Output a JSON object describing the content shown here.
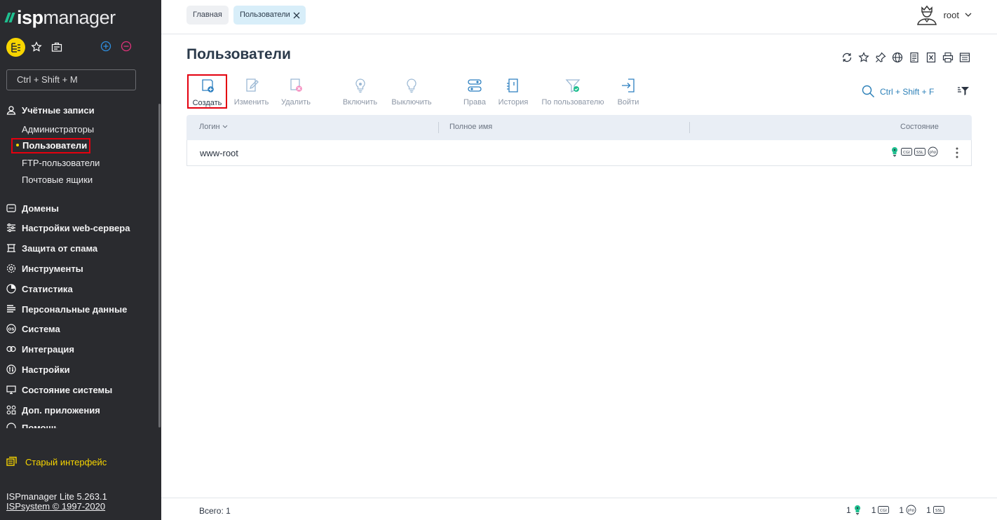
{
  "brand": {
    "logo_prefix": "isp",
    "logo_suffix": "manager",
    "accent": "#f7d500",
    "logo_color": "#1fbf8f"
  },
  "sidebar": {
    "hotkey_hint": "Ctrl + Shift + M",
    "accounts": {
      "label": "Учётные записи",
      "items": [
        {
          "label": "Администраторы"
        },
        {
          "label": "Пользователи",
          "active": true
        },
        {
          "label": "FTP-пользователи"
        },
        {
          "label": "Почтовые ящики"
        }
      ]
    },
    "sections": [
      {
        "label": "Домены",
        "icon": "domain-icon"
      },
      {
        "label": "Настройки web-сервера",
        "icon": "sliders-icon"
      },
      {
        "label": "Защита от спама",
        "icon": "shield-icon"
      },
      {
        "label": "Инструменты",
        "icon": "gear-icon"
      },
      {
        "label": "Статистика",
        "icon": "pie-chart-icon"
      },
      {
        "label": "Персональные данные",
        "icon": "list-icon"
      },
      {
        "label": "Система",
        "icon": "os-icon"
      },
      {
        "label": "Интеграция",
        "icon": "integration-icon"
      },
      {
        "label": "Настройки",
        "icon": "settings-icon"
      },
      {
        "label": "Состояние системы",
        "icon": "monitor-icon"
      },
      {
        "label": "Доп. приложения",
        "icon": "apps-icon"
      },
      {
        "label": "Помощь",
        "icon": "help-icon"
      }
    ],
    "old_interface": "Старый интерфейс",
    "version": "ISPmanager Lite 5.263.1",
    "copyright": "ISPsystem © 1997-2020"
  },
  "topbar": {
    "tabs": [
      {
        "label": "Главная"
      },
      {
        "label": "Пользователи"
      }
    ],
    "user": "root"
  },
  "page": {
    "title": "Пользователи"
  },
  "toolbar": {
    "buttons": [
      {
        "label": "Создать"
      },
      {
        "label": "Изменить"
      },
      {
        "label": "Удалить"
      },
      {
        "label": "Включить"
      },
      {
        "label": "Выключить"
      },
      {
        "label": "Права"
      },
      {
        "label": "История"
      },
      {
        "label": "По пользователю"
      },
      {
        "label": "Войти"
      }
    ],
    "search_hint": "Ctrl + Shift + F"
  },
  "table": {
    "columns": [
      {
        "label": "Логин"
      },
      {
        "label": "Полное имя"
      },
      {
        "label": "Состояние"
      }
    ],
    "rows": [
      {
        "login": "www-root",
        "full_name": "",
        "status_icons": [
          "key-icon",
          "cgi-icon",
          "ssl-icon",
          "php-icon"
        ]
      }
    ]
  },
  "footer": {
    "total": "Всего: 1",
    "stats": [
      {
        "count": "1",
        "icon": "key-icon"
      },
      {
        "count": "1",
        "icon": "cgi-icon"
      },
      {
        "count": "1",
        "icon": "php-icon"
      },
      {
        "count": "1",
        "icon": "ssl-icon"
      }
    ]
  }
}
